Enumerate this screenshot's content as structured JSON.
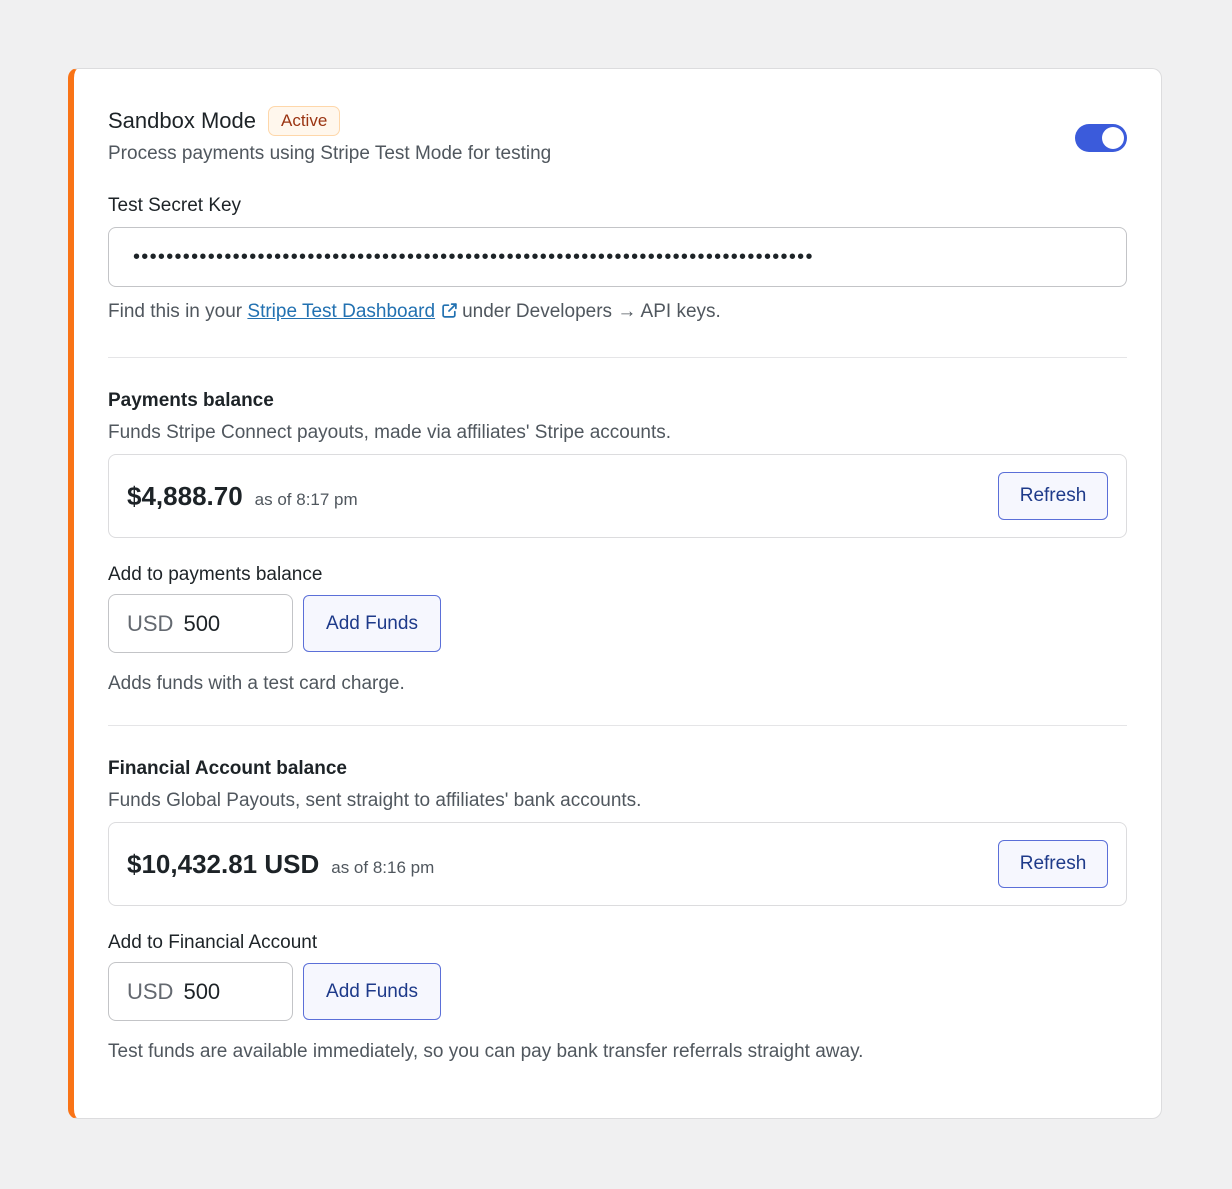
{
  "sandbox": {
    "title": "Sandbox Mode",
    "badge": "Active",
    "description": "Process payments using Stripe Test Mode for testing",
    "enabled": true
  },
  "secret_key": {
    "label": "Test Secret Key",
    "masked_value": "••••••••••••••••••••••••••••••••••••••••••••••••••••••••••••••••••••••••••••••••••",
    "help_prefix": "Find this in your",
    "help_link": "Stripe Test Dashboard",
    "help_suffix": "under Developers → API keys."
  },
  "payments_balance": {
    "title": "Payments balance",
    "description": "Funds Stripe Connect payouts, made via affiliates' Stripe accounts.",
    "amount": "$4,888.70",
    "as_of": "as of 8:17 pm",
    "refresh_label": "Refresh",
    "add_label": "Add to payments balance",
    "currency": "USD",
    "add_value": "500",
    "add_button": "Add Funds",
    "add_help": "Adds funds with a test card charge."
  },
  "financial_account": {
    "title": "Financial Account balance",
    "description": "Funds Global Payouts, sent straight to affiliates' bank accounts.",
    "amount": "$10,432.81 USD",
    "as_of": "as of 8:16 pm",
    "refresh_label": "Refresh",
    "add_label": "Add to Financial Account",
    "currency": "USD",
    "add_value": "500",
    "add_button": "Add Funds",
    "add_help": "Test funds are available immediately, so you can pay bank transfer referrals straight away."
  },
  "colors": {
    "accent_border": "#f97316",
    "toggle_on": "#3b5bdb",
    "link": "#2271b1",
    "button_text": "#1e3a8a"
  }
}
